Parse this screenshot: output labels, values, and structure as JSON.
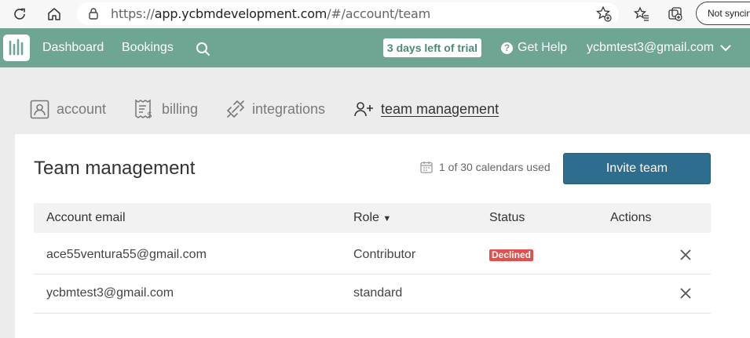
{
  "browser": {
    "url_prefix": "https://",
    "url_host": "app.ycbmdevelopment.com",
    "url_path": "/#/account/team",
    "sync_label": "Not syncing"
  },
  "header": {
    "nav": [
      "Dashboard",
      "Bookings"
    ],
    "trial": "3 days left of trial",
    "help": "Get Help",
    "help_glyph": "?",
    "user_email": "ycbmtest3@gmail.com"
  },
  "tabs": [
    {
      "label": "account",
      "icon": "account-icon",
      "active": false
    },
    {
      "label": "billing",
      "icon": "billing-icon",
      "active": false
    },
    {
      "label": "integrations",
      "icon": "integrations-icon",
      "active": false
    },
    {
      "label": "team management",
      "icon": "add-user-icon",
      "active": true
    }
  ],
  "card": {
    "title": "Team management",
    "calendars_used": "1 of 30 calendars used",
    "invite_label": "Invite team"
  },
  "table": {
    "columns": [
      "Account email",
      "Role",
      "Status",
      "Actions"
    ],
    "role_sort_glyph": "▼",
    "rows": [
      {
        "email": "ace55ventura55@gmail.com",
        "role": "Contributor",
        "status": "Declined"
      },
      {
        "email": "ycbmtest3@gmail.com",
        "role": "standard",
        "status": ""
      }
    ]
  },
  "colors": {
    "header_bg": "#6fa593",
    "invite_button": "#2f6d8e",
    "declined_badge": "#e0504d"
  }
}
